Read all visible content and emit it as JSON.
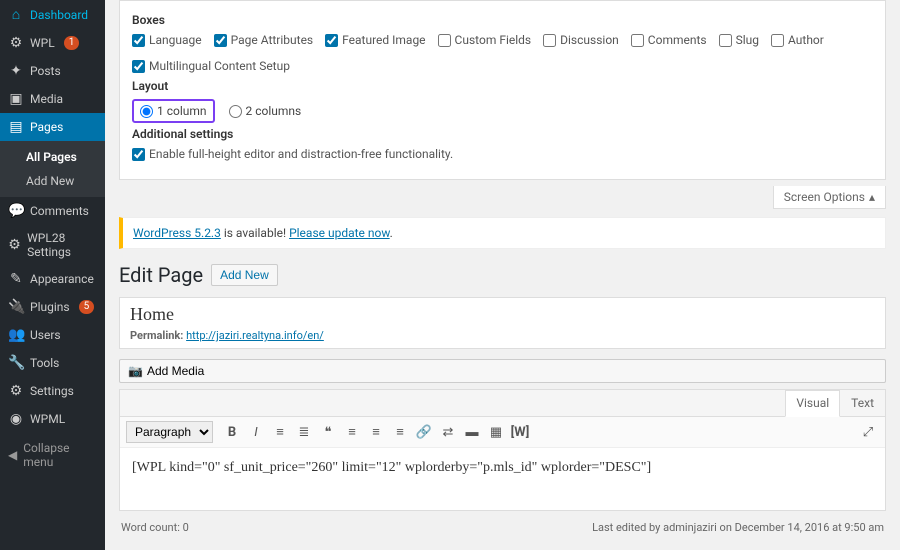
{
  "sidebar": {
    "dashboard": "Dashboard",
    "wpl": "WPL",
    "wpl_badge": "1",
    "posts": "Posts",
    "media": "Media",
    "pages": "Pages",
    "all_pages": "All Pages",
    "add_new": "Add New",
    "comments": "Comments",
    "wpl28": "WPL28 Settings",
    "appearance": "Appearance",
    "plugins": "Plugins",
    "plugins_badge": "5",
    "users": "Users",
    "tools": "Tools",
    "settings": "Settings",
    "wpml": "WPML",
    "collapse": "Collapse menu"
  },
  "panel": {
    "boxes": "Boxes",
    "lang": "Language",
    "pa": "Page Attributes",
    "fi": "Featured Image",
    "cf": "Custom Fields",
    "disc": "Discussion",
    "com": "Comments",
    "slug": "Slug",
    "auth": "Author",
    "mls": "Multilingual Content Setup",
    "layout": "Layout",
    "c1": "1 column",
    "c2": "2 columns",
    "addl": "Additional settings",
    "full": "Enable full-height editor and distraction-free functionality."
  },
  "screen_options": "Screen Options",
  "notice": {
    "t1": "WordPress 5.2.3",
    "t2": " is available! ",
    "t3": "Please update now",
    "t4": "."
  },
  "header": {
    "title": "Edit Page",
    "add": "Add New"
  },
  "title_value": "Home",
  "permalink": {
    "label": "Permalink: ",
    "url": "http://jaziri.realtyna.info/en/"
  },
  "add_media": "Add Media",
  "tabs": {
    "visual": "Visual",
    "text": "Text"
  },
  "format_dd": "Paragraph",
  "body": "[WPL kind=\"0\" sf_unit_price=\"260\" limit=\"12\" wplorderby=\"p.mls_id\" wplorder=\"DESC\"]",
  "footer": {
    "wc": "Word count: 0",
    "edited": "Last edited by adminjaziri on December 14, 2016 at 9:50 am"
  }
}
